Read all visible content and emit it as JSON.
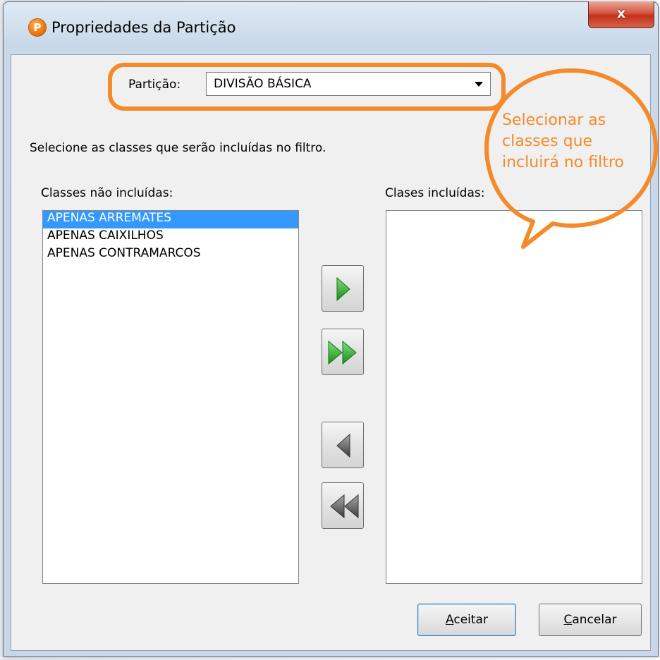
{
  "window": {
    "title": "Propriedades da Partição",
    "app_icon_letter": "P",
    "close_glyph": "x"
  },
  "partition": {
    "label": "Partição:",
    "selected_value": "DIVISÃO BÁSICA"
  },
  "instruction": "Selecione as classes que serão incluídas no filtro.",
  "left_list": {
    "header": "Classes não incluídas:",
    "items": [
      {
        "label": "APENAS ARREMATES",
        "selected": true
      },
      {
        "label": "APENAS CAIXILHOS",
        "selected": false
      },
      {
        "label": "APENAS CONTRAMARCOS",
        "selected": false
      }
    ]
  },
  "right_list": {
    "header": "Clases incluídas:",
    "items": []
  },
  "buttons": {
    "accept": {
      "mnemonic": "A",
      "rest": "ceitar"
    },
    "cancel": {
      "mnemonic": "C",
      "rest": "ancelar"
    }
  },
  "annotation": {
    "callout_lines": [
      "Selecionar as",
      "classes que",
      "incluirá no filtro"
    ]
  },
  "colors": {
    "annotation_orange": "#f58a2a",
    "selection_blue": "#3399ff",
    "arrow_green": "#2fa82f",
    "arrow_gray": "#5a5a5a"
  },
  "icons": {
    "add_one": "play-right-icon",
    "add_all": "double-play-right-icon",
    "remove_one": "play-left-icon",
    "remove_all": "double-play-left-icon"
  }
}
